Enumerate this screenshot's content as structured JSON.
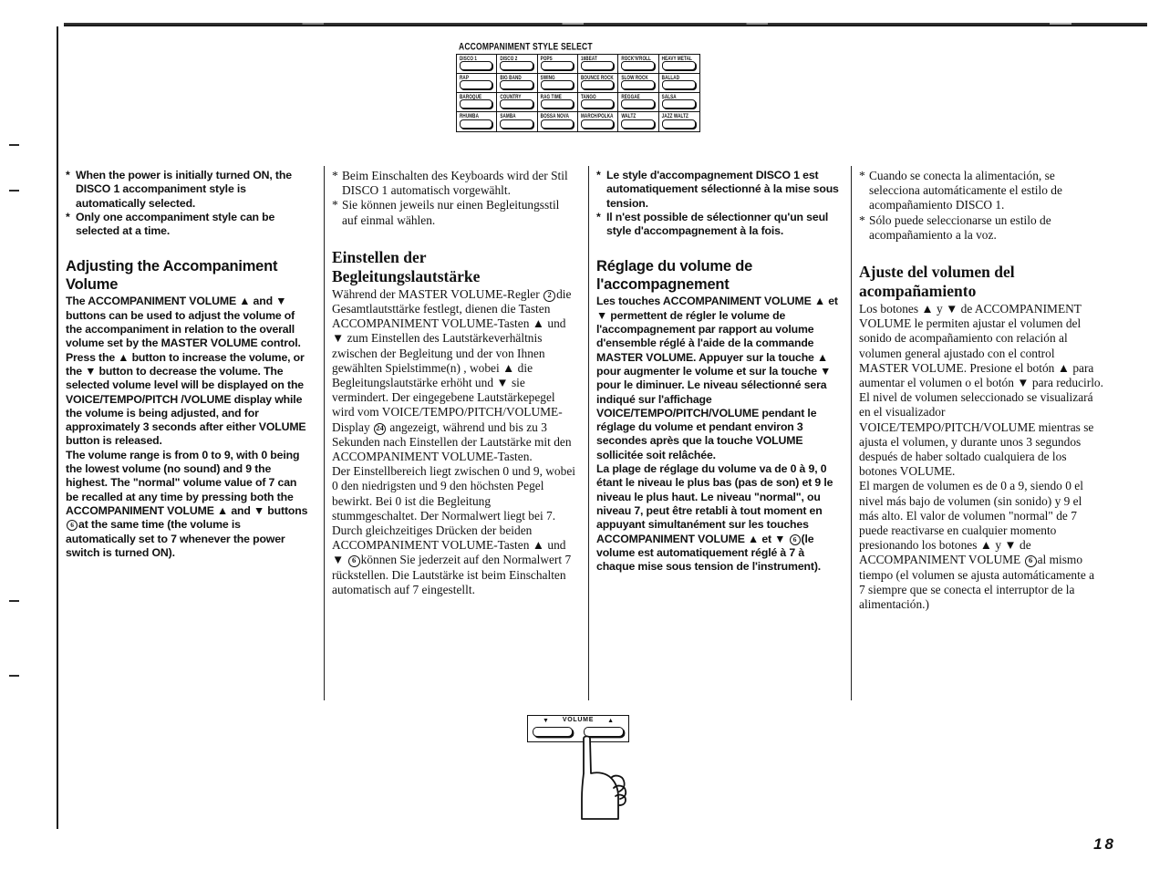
{
  "page": {
    "number": "18"
  },
  "panel": {
    "title": "ACCOMPANIMENT STYLE SELECT",
    "buttons": [
      "DISCO 1",
      "DISCO 2",
      "POPS",
      "16BEAT",
      "ROCK'N'ROLL",
      "HEAVY METAL",
      "RAP",
      "BIG BAND",
      "SWING",
      "BOUNCE ROCK",
      "SLOW ROCK",
      "BALLAD",
      "BAROQUE",
      "COUNTRY",
      "RAG TIME",
      "TANGO",
      "REGGAE",
      "SALSA",
      "RHUMBA",
      "SAMBA",
      "BOSSA NOVA",
      "MARCH/POLKA",
      "WALTZ",
      "JAZZ WALTZ"
    ]
  },
  "columns": {
    "english": {
      "lang": "English",
      "notes": [
        "When the power is initially turned ON, the DISCO 1 accompaniment style is automatically selected.",
        "Only one accompaniment style can be selected at a time."
      ],
      "heading": "Adjusting the Accompaniment Volume",
      "paragraph_1_a": "The ACCOMPANIMENT VOLUME ▲ and ▼ buttons can be used to adjust the volume of the accompaniment in relation to the overall volume set by the MASTER VOLUME control. Press the ▲ button to increase the volume, or the ▼ button to decrease the volume. The selected volume level will be displayed on the VOICE/TEMPO/PITCH /VOLUME display while the volume is being adjusted, and for approximately 3 seconds after either VOLUME button is released.",
      "paragraph_2_a": "The volume range is from 0 to 9, with 0 being the lowest volume (no sound) and 9 the highest. The \"normal\" volume value of 7 can be recalled at any time by pressing both the ACCOMPANIMENT VOLUME ▲ and ▼ buttons",
      "paragraph_2_ref": "6",
      "paragraph_2_b": "at the same time (the volume is automatically set to 7 whenever the power switch is turned ON)."
    },
    "german": {
      "lang": "Deutsch",
      "notes": [
        "Beim Einschalten des Keyboards wird der Stil DISCO 1 automatisch vorgewählt.",
        "Sie können jeweils nur einen Begleitungsstil auf einmal wählen."
      ],
      "heading": "Einstellen der Begleitungslautstärke",
      "paragraph_1_a": "Während der MASTER VOLUME-Regler",
      "paragraph_1_ref1": "2",
      "paragraph_1_b": "die Gesamtlautsttärke festlegt, dienen die Tasten ACCOMPANIMENT VOLUME-Tasten ▲ und ▼ zum Einstellen des Lautstärkeverhältnis zwischen der Begleitung und der von Ihnen gewählten Spielstimme(n) , wobei ▲ die Begleitungslautstärke erhöht und ▼ sie vermindert. Der eingegebene Lautstärkepegel wird vom VOICE/TEMPO/PITCH/VOLUME-Display",
      "paragraph_1_ref2": "24",
      "paragraph_1_c": "angezeigt, während und bis zu 3 Sekunden nach Einstellen der Lautstärke mit den ACCOMPANIMENT VOLUME-Tasten.",
      "paragraph_2_a": "Der Einstellbereich liegt zwischen 0 und 9, wobei 0 den niedrigsten und 9 den höchsten Pegel bewirkt. Bei 0 ist die Begleitung stummgeschaltet. Der Normalwert liegt bei 7. Durch gleichzeitiges Drücken der beiden ACCOMPANIMENT VOLUME-Tasten ▲ und ▼",
      "paragraph_2_ref": "6",
      "paragraph_2_b": "können Sie jederzeit auf den Normalwert 7 rückstellen. Die Lautstärke ist beim Einschalten automatisch auf 7 eingestellt."
    },
    "french": {
      "lang": "Français",
      "notes": [
        "Le style d'accompagnement DISCO 1 est automatiquement sélectionné à la mise sous tension.",
        "Il n'est possible de sélectionner qu'un seul style d'accompagnement à la fois."
      ],
      "heading": "Réglage du volume de l'accompagnement",
      "paragraph_1_a": "Les touches ACCOMPANIMENT VOLUME ▲ et ▼ permettent de régler le volume de l'accompagnement par rapport au volume d'ensemble réglé à l'aide de la commande MASTER VOLUME. Appuyer sur la touche ▲ pour augmenter le volume et sur la touche ▼ pour le diminuer. Le niveau sélectionné sera indiqué sur l'affichage VOICE/TEMPO/PITCH/VOLUME pendant le réglage du volume et pendant environ 3 secondes après que la touche VOLUME sollicitée soit relâchée.",
      "paragraph_2_a": "La plage de réglage du volume va de 0 à 9, 0 étant le niveau le plus bas (pas de son) et 9 le niveau le plus haut. Le niveau \"normal\", ou niveau 7, peut être retabli à tout moment en appuyant simultanément sur les touches ACCOMPANIMENT VOLUME ▲ et ▼",
      "paragraph_2_ref": "6",
      "paragraph_2_b": "(le volume est automatiquement réglé à 7 à chaque mise sous tension de l'instrument)."
    },
    "spanish": {
      "lang": "Español",
      "notes": [
        "Cuando se conecta la alimentación, se selecciona automáticamente el estilo de acompañamiento DISCO 1.",
        "Sólo puede seleccionarse un estilo de acompañamiento a la voz."
      ],
      "heading": "Ajuste del volumen del acompañamiento",
      "paragraph_1_a": "Los botones ▲ y ▼ de ACCOMPANIMENT VOLUME le permiten ajustar el volumen del sonido de acompañamiento con relación al volumen general ajustado con el control MASTER VOLUME. Presione el botón ▲ para aumentar el volumen o el botón ▼ para reducirlo. El nivel de volumen seleccionado se visualizará en el visualizador VOICE/TEMPO/PITCH/VOLUME mientras se ajusta el volumen, y durante unos 3 segundos después de haber soltado cualquiera de los botones VOLUME.",
      "paragraph_2_a": "El margen de volumen es de 0 a 9, siendo 0 el nivel más bajo de volumen (sin sonido) y 9 el más alto. El valor de volumen \"normal\" de 7 puede reactivarse en cualquier momento presionando los botones ▲ y ▼ de ACCOMPANIMENT VOLUME",
      "paragraph_2_ref": "6",
      "paragraph_2_b": "al mismo tiempo (el volumen se ajusta automáticamente a 7 siempre que se conecta el interruptor de la alimentación.)"
    }
  },
  "volume_figure": {
    "label": "VOLUME",
    "down_arrow": "▼",
    "up_arrow": "▲"
  }
}
